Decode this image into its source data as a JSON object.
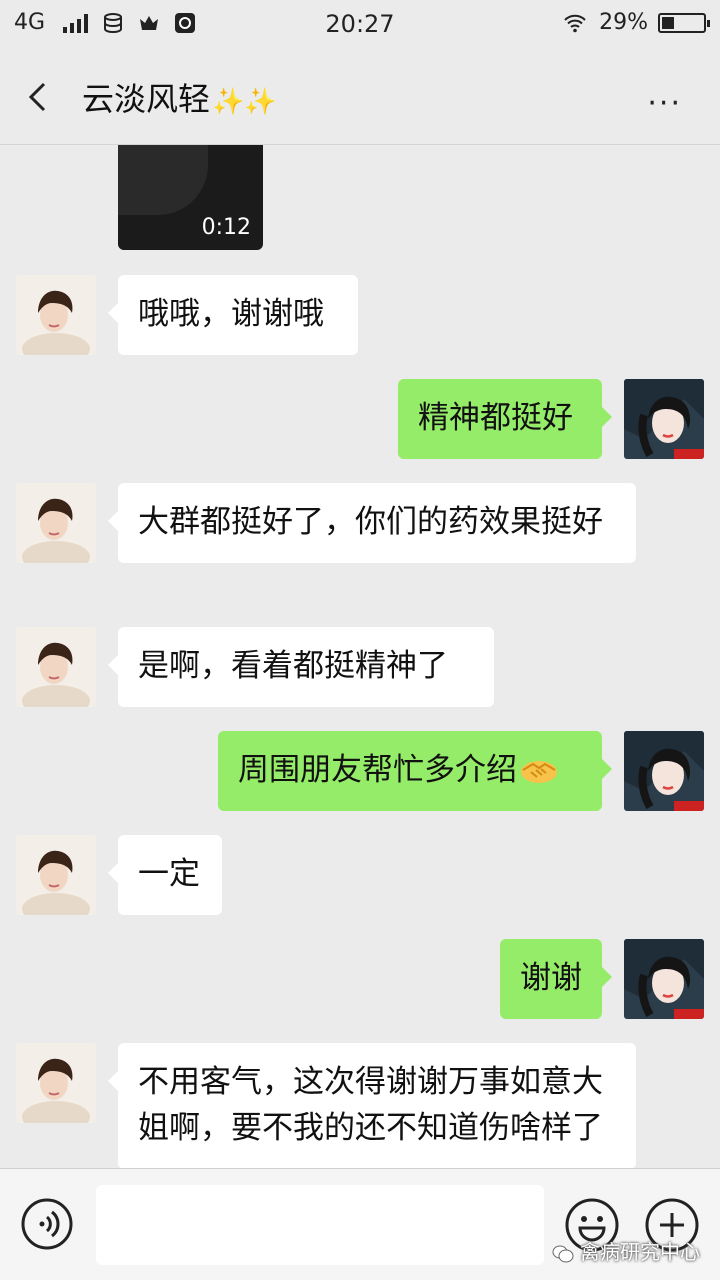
{
  "status_bar": {
    "network": "4G",
    "time": "20:27",
    "battery": "29%",
    "battery_level": 0.29
  },
  "header": {
    "title": "云淡风轻",
    "title_emoji": "✨✨",
    "more_label": "···"
  },
  "chat": {
    "video": {
      "duration": "0:12"
    },
    "messages": [
      {
        "side": "in",
        "text": "哦哦，谢谢哦"
      },
      {
        "side": "out",
        "text": "精神都挺好"
      },
      {
        "side": "in",
        "text": "大群都挺好了，你们的药效果挺好"
      },
      {
        "side": "in",
        "text": "是啊，看着都挺精神了"
      },
      {
        "side": "out",
        "text": "周围朋友帮忙多介绍",
        "emoji": "handshake"
      },
      {
        "side": "in",
        "text": "一定"
      },
      {
        "side": "out",
        "text": "谢谢"
      },
      {
        "side": "in",
        "text": "不用客气，这次得谢谢万事如意大姐啊，要不我的还不知道伤啥样了"
      }
    ]
  },
  "input_bar": {
    "text_value": "",
    "icons": [
      "voice-icon",
      "emoji-smile-icon",
      "plus-icon"
    ]
  },
  "watermark": "禽病研究中心",
  "colors": {
    "background": "#ebebeb",
    "incoming_bubble": "#ffffff",
    "outgoing_bubble": "#95ec69"
  }
}
